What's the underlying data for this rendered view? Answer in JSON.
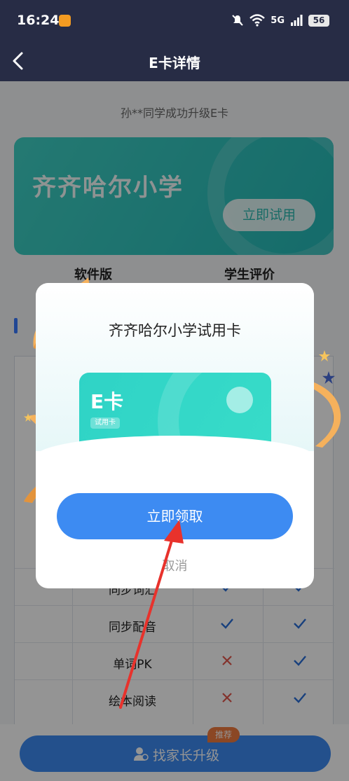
{
  "status_bar": {
    "time": "16:24",
    "network": "5G",
    "battery": "56"
  },
  "nav": {
    "title": "E卡详情",
    "back_icon": "chevron-left-icon"
  },
  "page": {
    "notice": "孙**同学成功升级E卡",
    "hero": {
      "school_name": "齐齐哈尔小学",
      "try_button": "立即试用"
    },
    "tabs": [
      "软件版",
      "学生评价"
    ],
    "feature_rows": [
      {
        "feature": "同步词汇",
        "col1": "check",
        "col2": "check"
      },
      {
        "feature": "同步配音",
        "col1": "check",
        "col2": "check"
      },
      {
        "feature": "单词PK",
        "col1": "cross",
        "col2": "check"
      },
      {
        "feature": "绘本阅读",
        "col1": "cross",
        "col2": "check"
      }
    ],
    "upgrade_button": "找家长升级",
    "upgrade_badge": "推荐"
  },
  "modal": {
    "title": "齐齐哈尔小学试用卡",
    "card_label": "E卡",
    "card_tag": "试用卡",
    "claim_button": "立即领取",
    "cancel_button": "取消"
  },
  "colors": {
    "nav_bg": "#272c45",
    "accent_blue": "#3d8bf2",
    "card_teal": "#2fd3c6",
    "check_blue": "#2a6fd8",
    "cross_red": "#e2574c",
    "badge_orange": "#f07a3e",
    "annotation_red": "#e8322c"
  }
}
